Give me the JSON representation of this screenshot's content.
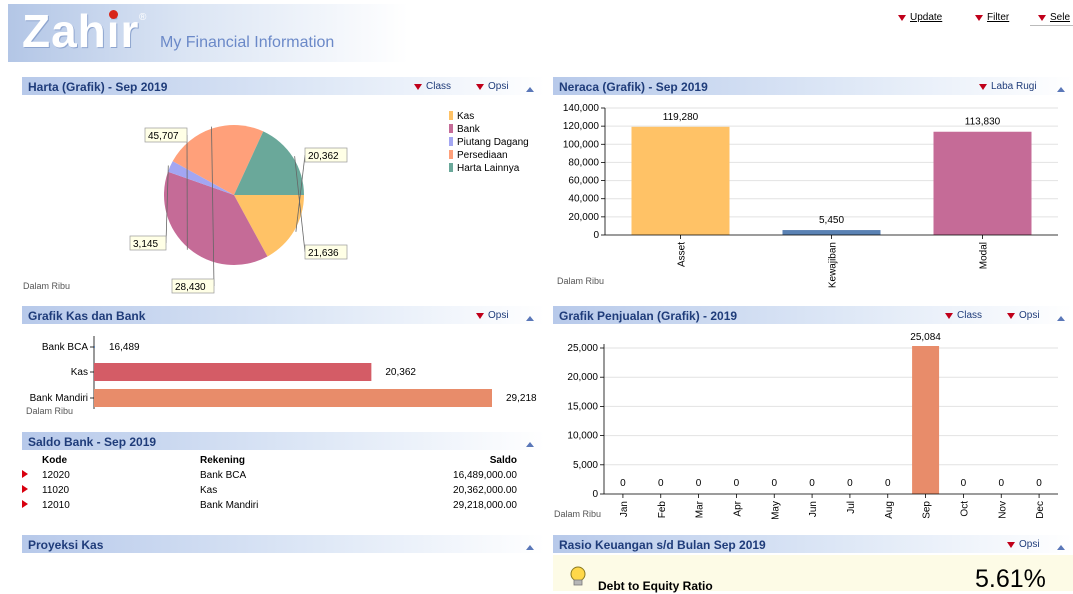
{
  "header": {
    "logo": "Zahir",
    "logo_mark": "®",
    "title": "My Financial Information",
    "buttons": [
      {
        "label": "Update",
        "icon": "dropdown-triangle-icon"
      },
      {
        "label": "Filter",
        "icon": "dropdown-triangle-icon"
      },
      {
        "label": "Sele",
        "icon": "dropdown-triangle-icon"
      }
    ]
  },
  "panels": {
    "harta": {
      "title": "Harta (Grafik) - Sep 2019",
      "ctrl_class": "Class",
      "ctrl_opsi": "Opsi",
      "note": "Dalam Ribu"
    },
    "neraca": {
      "title": "Neraca (Grafik) - Sep 2019",
      "ctrl_laba": "Laba Rugi"
    },
    "kasbank": {
      "title": "Grafik Kas dan Bank",
      "ctrl_opsi": "Opsi",
      "note": "Dalam Ribu"
    },
    "penjualan": {
      "title": "Grafik Penjualan (Grafik) - 2019",
      "ctrl_class": "Class",
      "ctrl_opsi": "Opsi",
      "note": "Dalam Ribu"
    },
    "saldo": {
      "title": "Saldo Bank - Sep 2019",
      "columns": [
        "Kode",
        "Rekening",
        "Saldo"
      ],
      "rows": [
        {
          "kode": "12020",
          "rekening": "Bank BCA",
          "saldo": "16,489,000.00"
        },
        {
          "kode": "11020",
          "rekening": "Kas",
          "saldo": "20,362,000.00"
        },
        {
          "kode": "12010",
          "rekening": "Bank Mandiri",
          "saldo": "29,218,000.00"
        }
      ]
    },
    "proyeksi": {
      "title": "Proyeksi Kas"
    },
    "rasio": {
      "title": "Rasio Keuangan s/d Bulan Sep 2019",
      "ctrl_opsi": "Opsi",
      "metric_label": "Debt to Equity Ratio",
      "metric_value": "5.61%"
    }
  },
  "chart_data": [
    {
      "type": "pie",
      "legend": [
        "Kas",
        "Bank",
        "Piutang Dagang",
        "Persediaan",
        "Harta Lainnya"
      ],
      "values": [
        20362,
        45707,
        3145,
        28430,
        21636
      ],
      "labels": [
        "20,362",
        "45,707",
        "3,145",
        "28,430",
        "21,636"
      ],
      "colors": [
        "#ffc266",
        "#c56b97",
        "#a3a6f2",
        "#ffa07a",
        "#6aa89a"
      ],
      "legend_placement": "top-right"
    },
    {
      "type": "bar",
      "categories": [
        "Asset",
        "Kewajiban",
        "Modal"
      ],
      "values": [
        119280,
        5450,
        113830
      ],
      "labels": [
        "119,280",
        "5,450",
        "113,830"
      ],
      "colors": [
        "#ffc266",
        "#5a82b4",
        "#c56b97"
      ],
      "ylim": [
        0,
        140000
      ],
      "yticks": [
        "0",
        "20,000",
        "40,000",
        "60,000",
        "80,000",
        "100,000",
        "120,000",
        "140,000"
      ],
      "grid": true
    },
    {
      "type": "bar",
      "orientation": "horizontal",
      "categories": [
        "Bank BCA",
        "Kas",
        "Bank Mandiri"
      ],
      "values": [
        16489,
        20362,
        29218
      ],
      "labels": [
        "16,489",
        "20,362",
        "29,218"
      ],
      "colors": [
        "#5a82b4",
        "#d45c66",
        "#e88c6a"
      ]
    },
    {
      "type": "bar",
      "categories": [
        "Jan",
        "Feb",
        "Mar",
        "Apr",
        "May",
        "Jun",
        "Jul",
        "Aug",
        "Sep",
        "Oct",
        "Nov",
        "Dec"
      ],
      "values": [
        0,
        0,
        0,
        0,
        0,
        0,
        0,
        0,
        25084,
        0,
        0,
        0
      ],
      "labels": [
        "0",
        "0",
        "0",
        "0",
        "0",
        "0",
        "0",
        "0",
        "25,084",
        "0",
        "0",
        "0"
      ],
      "colors": [
        "#e88c6a"
      ],
      "ylim": [
        0,
        25000
      ],
      "yticks": [
        "0",
        "5,000",
        "10,000",
        "15,000",
        "20,000",
        "25,000"
      ],
      "grid": true
    }
  ]
}
